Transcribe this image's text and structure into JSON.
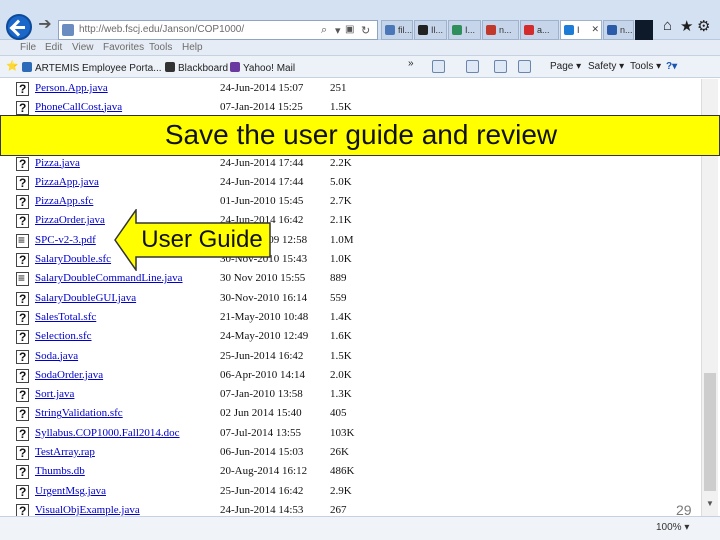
{
  "browser": {
    "url": "http://web.fscj.edu/Janson/COP1000/",
    "tabs": [
      {
        "label": "fil...",
        "color": "#4b77b8",
        "active": false
      },
      {
        "label": "Il...",
        "color": "#222222",
        "active": false
      },
      {
        "label": "I...",
        "color": "#2f8f5c",
        "active": false
      },
      {
        "label": "n...",
        "color": "#c0392b",
        "active": false
      },
      {
        "label": "a...",
        "color": "#d42c2c",
        "active": false
      },
      {
        "label": "I",
        "color": "#1c7cd6",
        "active": true
      },
      {
        "label": "n...",
        "color": "#2a5aa8",
        "active": false
      }
    ],
    "tab_close": "✕",
    "menu": [
      "File",
      "Edit",
      "View",
      "Favorites",
      "Tools",
      "Help"
    ],
    "favorites": [
      {
        "label": "ARTEMIS Employee Porta...",
        "color": "#2c6bb8"
      },
      {
        "label": "Blackboard",
        "color": "#333333"
      },
      {
        "label": "Yahoo! Mail",
        "color": "#6a3aa0"
      }
    ],
    "overflow_chevron": "»",
    "commands": {
      "page": "Page",
      "safety": "Safety",
      "tools": "Tools"
    },
    "zoom": "100%"
  },
  "files": [
    {
      "name": "Person.App.java",
      "date": "24-Jun-2014 15:07",
      "size": "251",
      "icon": "unknown"
    },
    {
      "name": "PhoneCallCost.java",
      "date": "07-Jan-2014 15:25",
      "size": "1.5K",
      "icon": "unknown"
    },
    {
      "name": "Pizza.java",
      "date": "24-Jun-2014 17:44",
      "size": "2.2K",
      "icon": "unknown"
    },
    {
      "name": "PizzaApp.java",
      "date": "24-Jun-2014 17:44",
      "size": "5.0K",
      "icon": "unknown"
    },
    {
      "name": "PizzaApp.sfc",
      "date": "01-Jun-2010 15:45",
      "size": "2.7K",
      "icon": "unknown"
    },
    {
      "name": "PizzaOrder.java",
      "date": "24-Jun-2014 16:42",
      "size": "2.1K",
      "icon": "unknown"
    },
    {
      "name": "SPC-v2-3.pdf",
      "date": "04-Nov-2009 12:58",
      "size": "1.0M",
      "icon": "doc"
    },
    {
      "name": "SalaryDouble.sfc",
      "date": "30-Nov-2010 15:43",
      "size": "1.0K",
      "icon": "unknown"
    },
    {
      "name": "SalaryDoubleCommandLine.java",
      "date": "30 Nov 2010 15:55",
      "size": "889",
      "icon": "doc"
    },
    {
      "name": "SalaryDoubleGUI.java",
      "date": "30-Nov-2010 16:14",
      "size": "559",
      "icon": "unknown"
    },
    {
      "name": "SalesTotal.sfc",
      "date": "21-May-2010 10:48",
      "size": "1.4K",
      "icon": "unknown"
    },
    {
      "name": "Selection.sfc",
      "date": "24-May-2010 12:49",
      "size": "1.6K",
      "icon": "unknown"
    },
    {
      "name": "Soda.java",
      "date": "25-Jun-2014 16:42",
      "size": "1.5K",
      "icon": "unknown"
    },
    {
      "name": "SodaOrder.java",
      "date": "06-Apr-2010 14:14",
      "size": "2.0K",
      "icon": "unknown"
    },
    {
      "name": "Sort.java",
      "date": "07-Jan-2010 13:58",
      "size": "1.3K",
      "icon": "unknown"
    },
    {
      "name": "StringValidation.sfc",
      "date": "02 Jun 2014 15:40",
      "size": "405",
      "icon": "unknown"
    },
    {
      "name": "Syllabus.COP1000.Fall2014.doc",
      "date": "07-Jul-2014 13:55",
      "size": "103K",
      "icon": "unknown"
    },
    {
      "name": "TestArray.rap",
      "date": "06-Jun-2014 15:03",
      "size": "26K",
      "icon": "unknown"
    },
    {
      "name": "Thumbs.db",
      "date": "20-Aug-2014 16:12",
      "size": "486K",
      "icon": "unknown"
    },
    {
      "name": "UrgentMsg.java",
      "date": "25-Jun-2014 16:42",
      "size": "2.9K",
      "icon": "unknown"
    },
    {
      "name": "VisualObjExample.java",
      "date": "24-Jun-2014 14:53",
      "size": "267",
      "icon": "unknown"
    }
  ],
  "overlay": {
    "banner": "Save the user guide and review",
    "callout": "User Guide",
    "banner_color": "#ffff00",
    "callout_color": "#ffff00"
  },
  "page_number": "29"
}
